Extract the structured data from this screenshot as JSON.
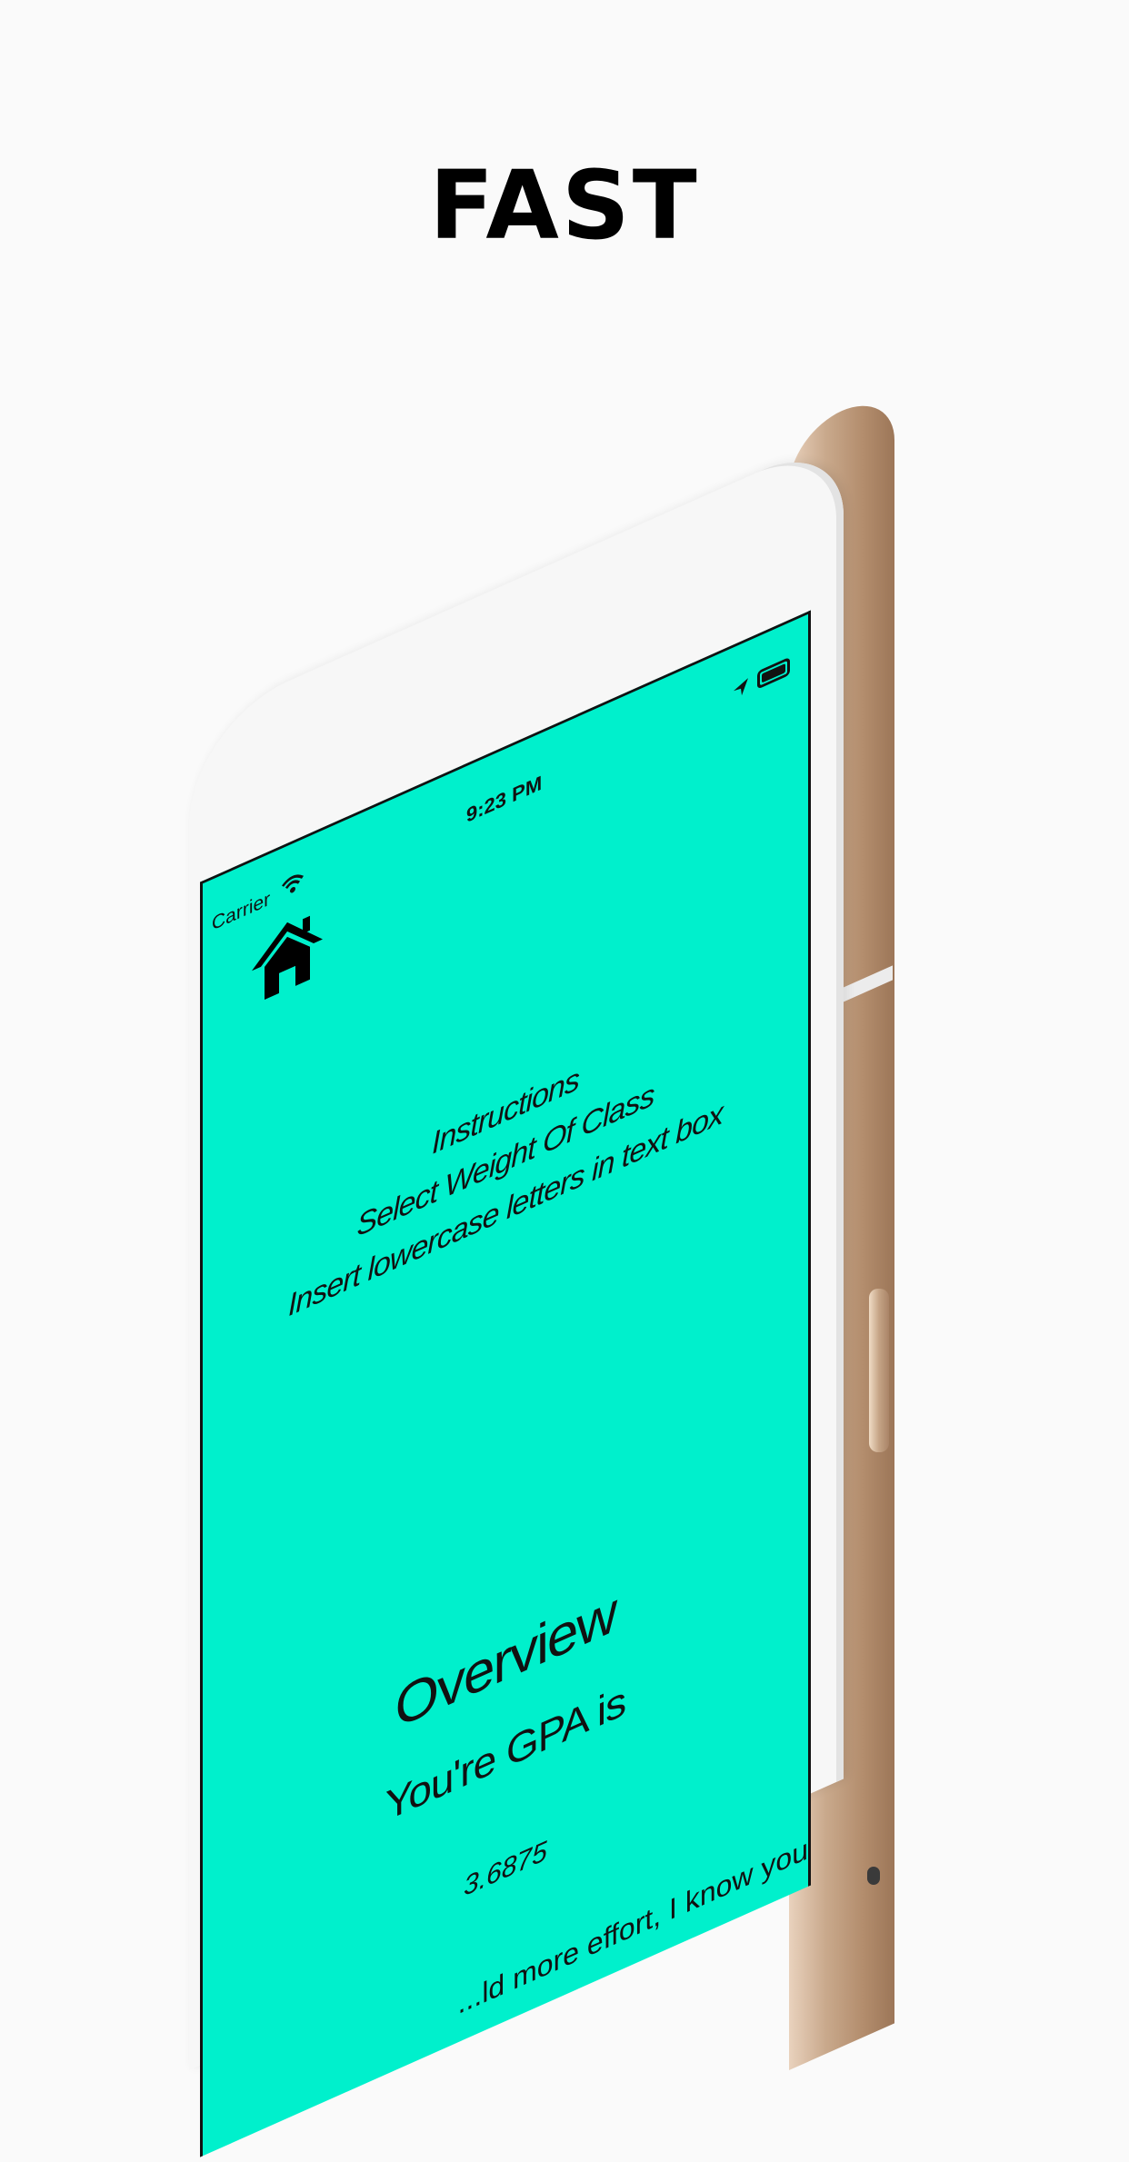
{
  "headline": "FAST",
  "status_bar": {
    "carrier": "Carrier",
    "time": "9:23 PM"
  },
  "icons": {
    "home": "home-icon",
    "wifi": "wifi-icon",
    "location": "location-arrow-icon",
    "battery": "battery-icon"
  },
  "colors": {
    "screen_background": "#00f0cc",
    "page_background": "#fafafa",
    "phone_frame": "#c9a98c"
  },
  "instructions": {
    "title": "Instructions",
    "line1": "Select Weight Of Class",
    "line2": "Insert lowercase letters in text box"
  },
  "overview": {
    "title": "Overview",
    "gpa_label": "You're GPA is",
    "gpa_value": "3.6875",
    "advice_partial": "...ld more effort, I know you"
  }
}
